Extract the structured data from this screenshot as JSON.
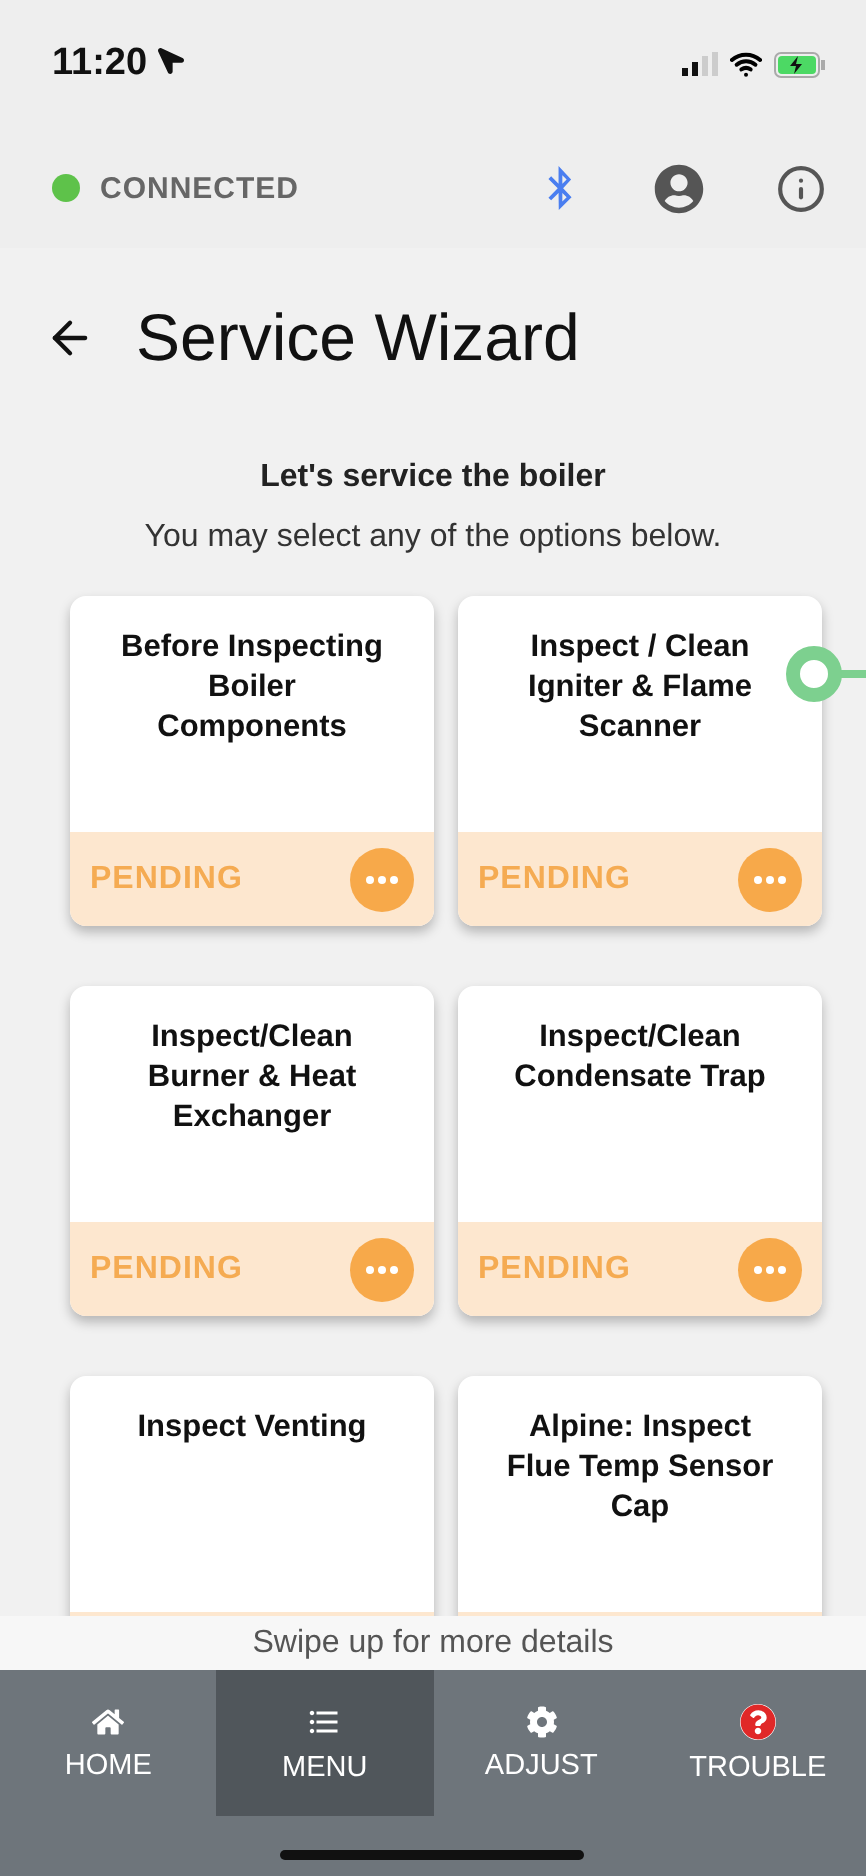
{
  "status_bar": {
    "time": "11:20"
  },
  "connection": {
    "label": "CONNECTED",
    "color": "#5ec24a"
  },
  "page": {
    "title": "Service Wizard",
    "heading": "Let's service the boiler",
    "subheading": "You may select any of the options below."
  },
  "cards": [
    {
      "title": "Before Inspecting Boiler Components",
      "status": "PENDING",
      "highlighted": false
    },
    {
      "title": "Inspect / Clean Igniter & Flame Scanner",
      "status": "PENDING",
      "highlighted": true
    },
    {
      "title": "Inspect/Clean Burner & Heat Exchanger",
      "status": "PENDING",
      "highlighted": false
    },
    {
      "title": "Inspect/Clean Condensate Trap",
      "status": "PENDING",
      "highlighted": false
    },
    {
      "title": "Inspect Venting",
      "highlighted": false
    },
    {
      "title": "Alpine: Inspect Flue Temp Sensor Cap",
      "highlighted": false
    }
  ],
  "swipe_hint": "Swipe up for more details",
  "nav": [
    {
      "kind": "home",
      "label": "HOME",
      "selected": false
    },
    {
      "kind": "menu",
      "label": "MENU",
      "selected": true
    },
    {
      "kind": "adjust",
      "label": "ADJUST",
      "selected": false
    },
    {
      "kind": "trouble",
      "label": "TROUBLE",
      "selected": false
    }
  ]
}
